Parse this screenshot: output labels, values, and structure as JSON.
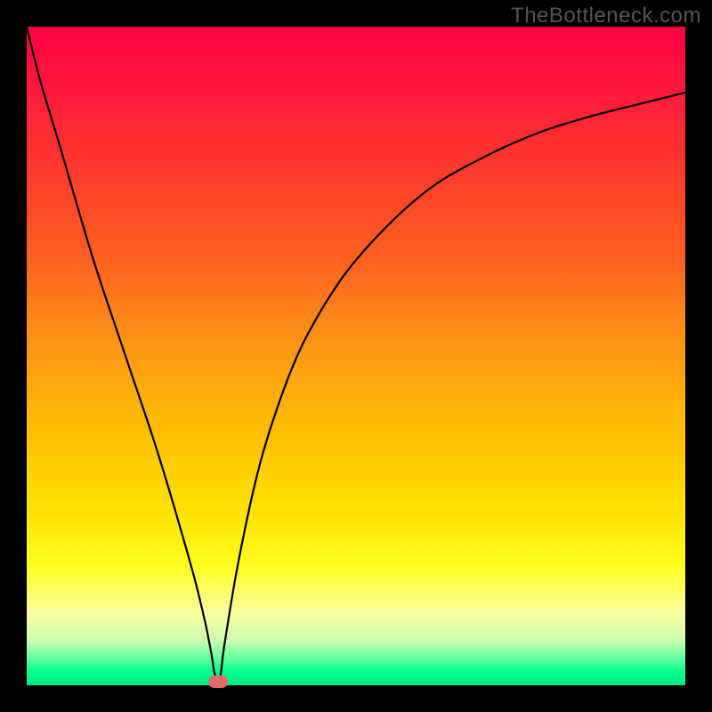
{
  "watermark": "TheBottleneck.com",
  "chart_data": {
    "type": "line",
    "title": "",
    "xlabel": "",
    "ylabel": "",
    "xlim": [
      0,
      100
    ],
    "ylim": [
      0,
      100
    ],
    "series": [
      {
        "name": "bottleneck-curve",
        "x": [
          0,
          2,
          5,
          10,
          15,
          20,
          25,
          27,
          28,
          28.5,
          29,
          29.5,
          30,
          32,
          35,
          38,
          42,
          48,
          55,
          62,
          70,
          78,
          86,
          94,
          100
        ],
        "y": [
          100,
          92,
          82,
          65,
          50,
          35,
          18,
          10,
          5,
          2,
          0.5,
          2,
          6,
          18,
          32,
          42,
          52,
          62,
          70,
          76,
          80.5,
          84,
          86.5,
          88.5,
          90
        ]
      }
    ],
    "marker": {
      "name": "optimal-point",
      "x": 29,
      "y": 0.5,
      "color": "#e26a6a"
    },
    "background_gradient": {
      "top": "#ff0040",
      "mid": "#ffe000",
      "bottom": "#00e880"
    }
  }
}
